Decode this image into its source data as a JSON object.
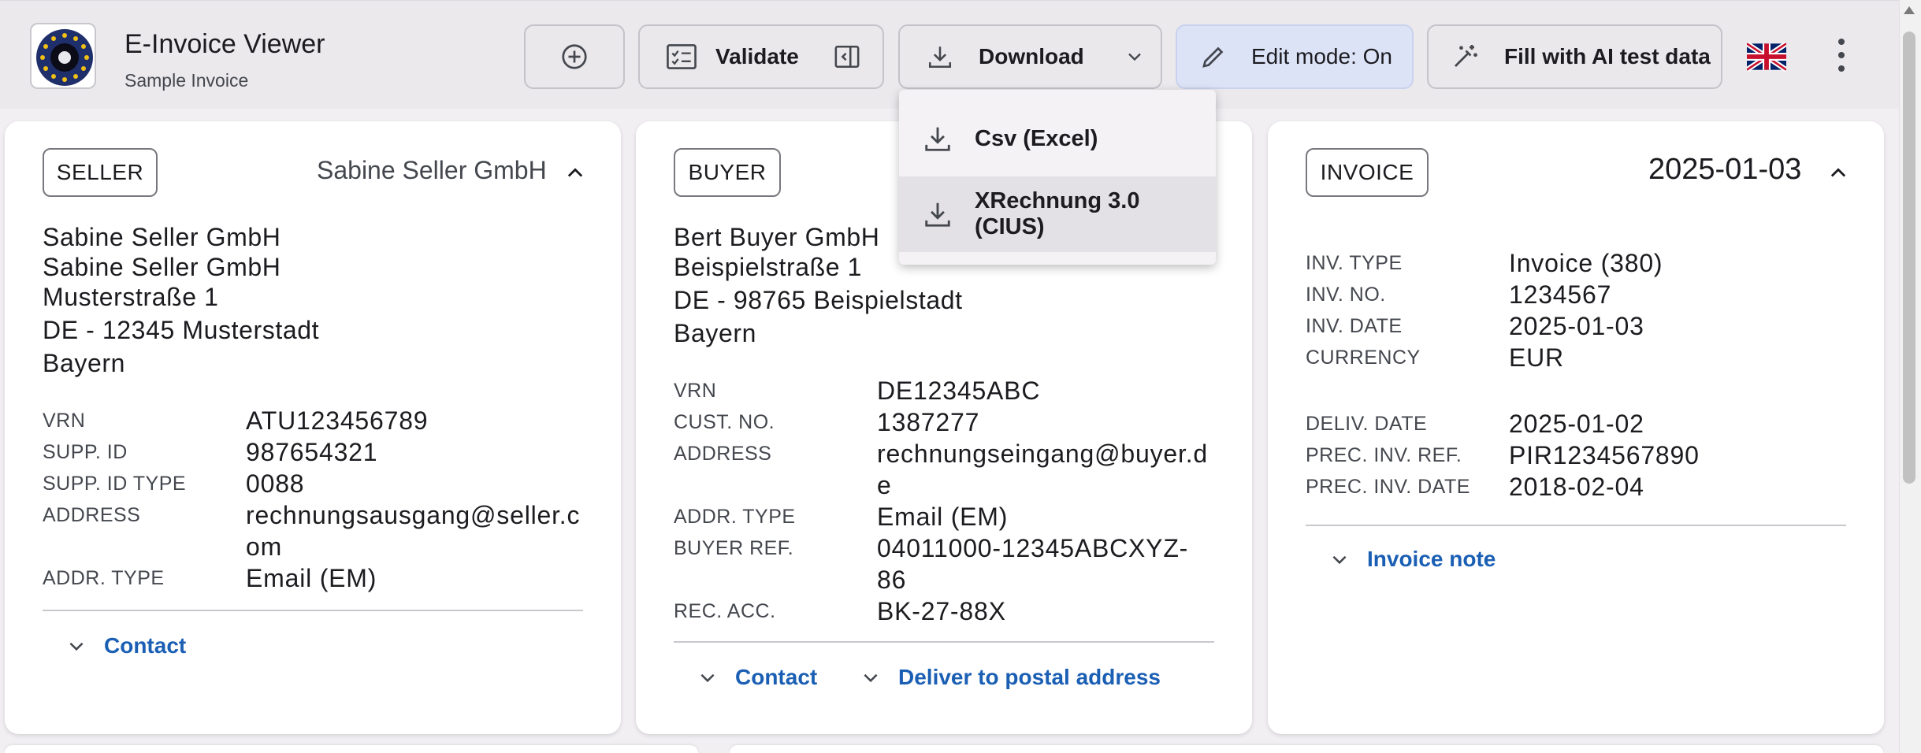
{
  "app": {
    "title": "E-Invoice Viewer",
    "subtitle": "Sample Invoice"
  },
  "toolbar": {
    "validate_label": "Validate",
    "download_label": "Download",
    "edit_label": "Edit mode: On",
    "ai_label": "Fill with AI test data"
  },
  "download_menu": {
    "items": [
      {
        "label": "Csv (Excel)"
      },
      {
        "label": "XRechnung 3.0 (CIUS)"
      }
    ]
  },
  "seller": {
    "chip": "SELLER",
    "header": "Sabine Seller GmbH",
    "address": [
      "Sabine Seller GmbH",
      "Sabine Seller GmbH",
      "Musterstraße 1",
      "DE - 12345 Musterstadt",
      "Bayern"
    ],
    "fields": [
      {
        "k": "VRN",
        "v": "ATU123456789"
      },
      {
        "k": "SUPP. ID",
        "v": "987654321"
      },
      {
        "k": "SUPP. ID TYPE",
        "v": "0088"
      },
      {
        "k": "ADDRESS",
        "v": "rechnungsausgang@seller.com"
      },
      {
        "k": "ADDR. TYPE",
        "v": "Email (EM)"
      }
    ],
    "contact": "Contact"
  },
  "buyer": {
    "chip": "BUYER",
    "address": [
      "Bert Buyer GmbH",
      "Beispielstraße 1",
      "DE - 98765 Beispielstadt",
      "Bayern"
    ],
    "fields": [
      {
        "k": "VRN",
        "v": "DE12345ABC"
      },
      {
        "k": "CUST. NO.",
        "v": "1387277"
      },
      {
        "k": "ADDRESS",
        "v": "rechnungseingang@buyer.de"
      },
      {
        "k": "ADDR. TYPE",
        "v": "Email (EM)"
      },
      {
        "k": "BUYER REF.",
        "v": "04011000-12345ABCXYZ-86"
      },
      {
        "k": "REC. ACC.",
        "v": "BK-27-88X"
      }
    ],
    "contact": "Contact",
    "deliver": "Deliver to postal address"
  },
  "invoice": {
    "chip": "INVOICE",
    "header": "2025-01-03",
    "fields1": [
      {
        "k": "INV. TYPE",
        "v": "Invoice (380)"
      },
      {
        "k": "INV. NO.",
        "v": "1234567"
      },
      {
        "k": "INV. DATE",
        "v": "2025-01-03"
      },
      {
        "k": "CURRENCY",
        "v": "EUR"
      }
    ],
    "fields2": [
      {
        "k": "DELIV. DATE",
        "v": "2025-01-02"
      },
      {
        "k": "PREC. INV. REF.",
        "v": "PIR1234567890"
      },
      {
        "k": "PREC. INV. DATE",
        "v": "2018-02-04"
      }
    ],
    "note": "Invoice note"
  },
  "colors": {
    "accent": "#1a5fb4",
    "edit_bg": "#dce3f7",
    "page_bg": "#f1eff2"
  }
}
